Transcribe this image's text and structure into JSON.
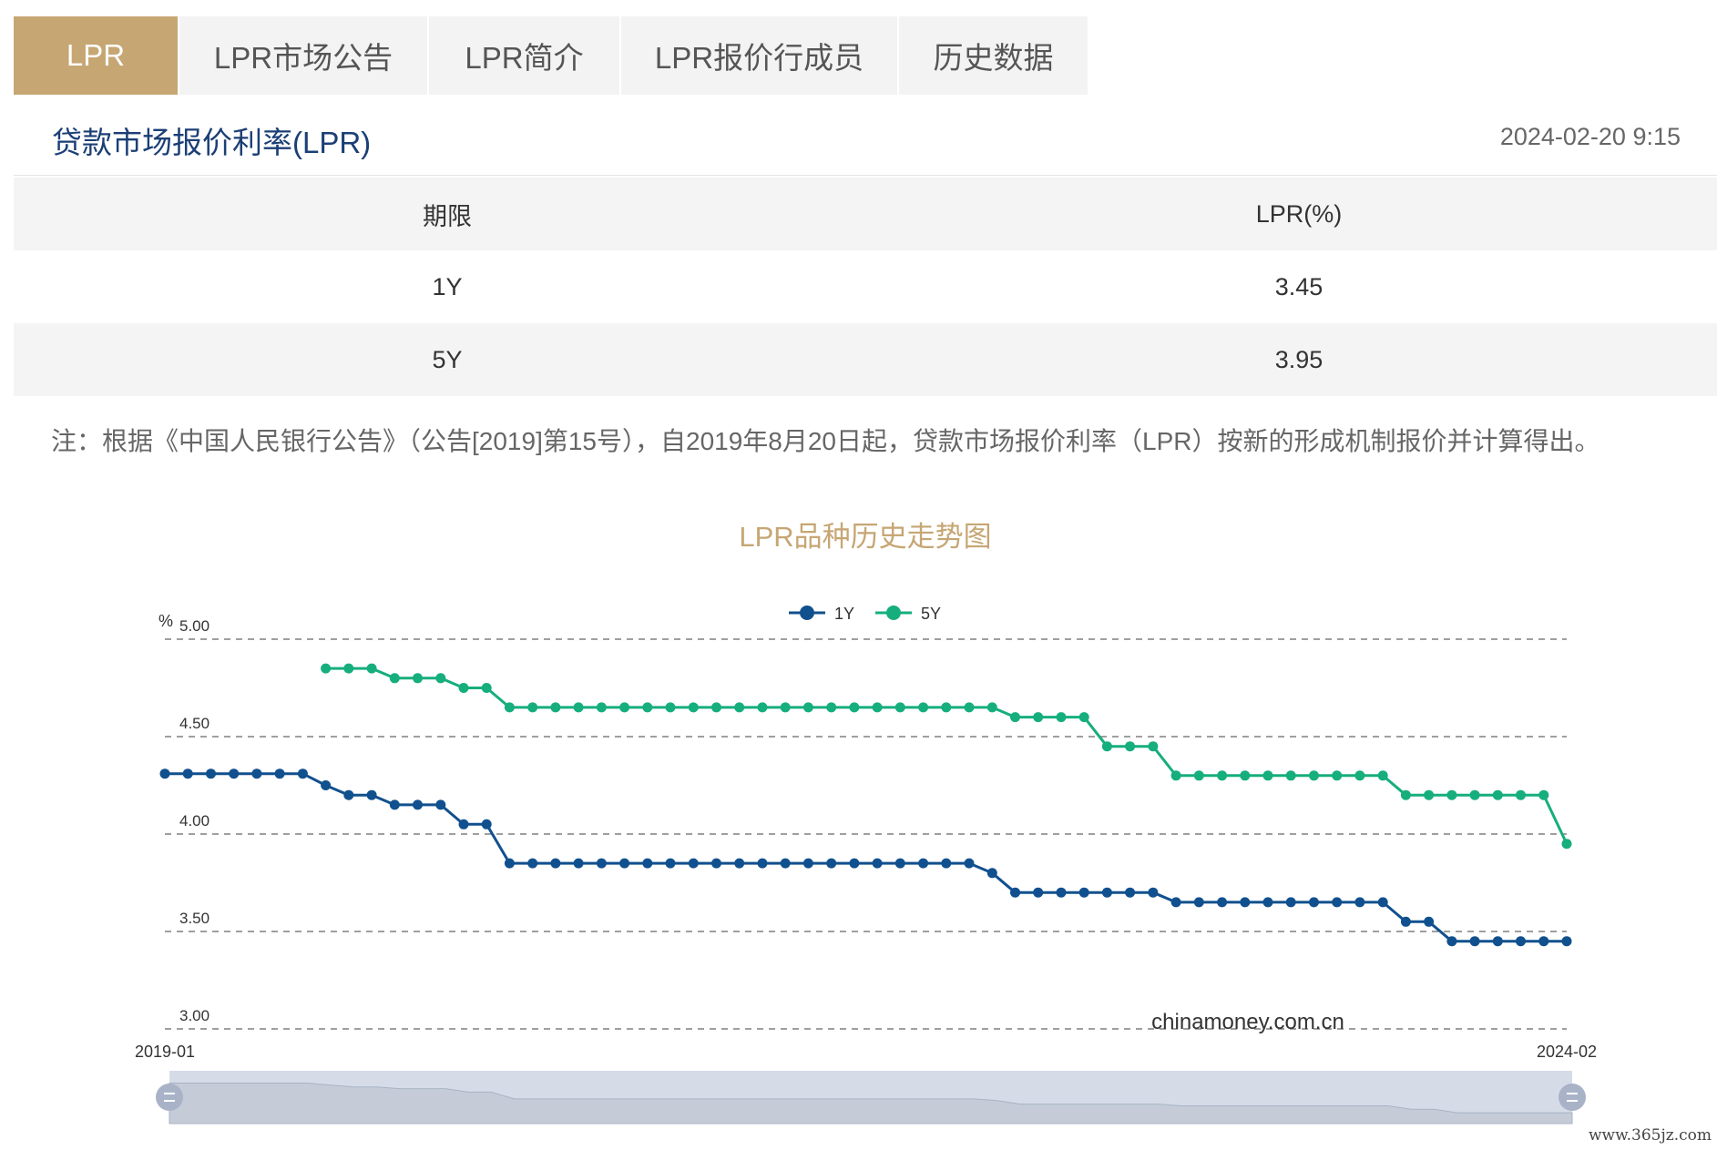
{
  "tabs": [
    {
      "label": "LPR",
      "active": true
    },
    {
      "label": "LPR市场公告",
      "active": false
    },
    {
      "label": "LPR简介",
      "active": false
    },
    {
      "label": "LPR报价行成员",
      "active": false
    },
    {
      "label": "历史数据",
      "active": false
    }
  ],
  "header": {
    "title": "贷款市场报价利率(LPR)",
    "timestamp": "2024-02-20 9:15"
  },
  "rate_table": {
    "headers": [
      "期限",
      "LPR(%)"
    ],
    "rows": [
      {
        "term": "1Y",
        "rate": "3.45"
      },
      {
        "term": "5Y",
        "rate": "3.95"
      }
    ]
  },
  "note": "注：根据《中国人民银行公告》（公告[2019]第15号），自2019年8月20日起，贷款市场报价利率（LPR）按新的形成机制报价并计算得出。",
  "site_watermark": "www.365jz.com",
  "colors": {
    "accent": "#c6a673",
    "title_blue": "#1b3f75",
    "series_1y": "#11508e",
    "series_5y": "#16ae7d"
  },
  "chart_data": {
    "type": "line",
    "title": "LPR品种历史走势图",
    "unit_label": "%",
    "watermark": "chinamoney.com.cn",
    "ylim": [
      3.0,
      5.0
    ],
    "y_ticks": [
      "5.00",
      "4.50",
      "4.00",
      "3.50",
      "3.00"
    ],
    "x_labels": [
      "2019-01",
      "2024-02"
    ],
    "grid": "horizontal-dashed",
    "legend_position": "top-center",
    "x": [
      "2019-01",
      "2019-02",
      "2019-03",
      "2019-04",
      "2019-05",
      "2019-06",
      "2019-07",
      "2019-08",
      "2019-09",
      "2019-10",
      "2019-11",
      "2019-12",
      "2020-01",
      "2020-02",
      "2020-03",
      "2020-04",
      "2020-05",
      "2020-06",
      "2020-07",
      "2020-08",
      "2020-09",
      "2020-10",
      "2020-11",
      "2020-12",
      "2021-01",
      "2021-02",
      "2021-03",
      "2021-04",
      "2021-05",
      "2021-06",
      "2021-07",
      "2021-08",
      "2021-09",
      "2021-10",
      "2021-11",
      "2021-12",
      "2022-01",
      "2022-02",
      "2022-03",
      "2022-04",
      "2022-05",
      "2022-06",
      "2022-07",
      "2022-08",
      "2022-09",
      "2022-10",
      "2022-11",
      "2022-12",
      "2023-01",
      "2023-02",
      "2023-03",
      "2023-04",
      "2023-05",
      "2023-06",
      "2023-07",
      "2023-08",
      "2023-09",
      "2023-10",
      "2023-11",
      "2023-12",
      "2024-01",
      "2024-02"
    ],
    "series": [
      {
        "name": "1Y",
        "values": [
          4.31,
          4.31,
          4.31,
          4.31,
          4.31,
          4.31,
          4.31,
          4.25,
          4.2,
          4.2,
          4.15,
          4.15,
          4.15,
          4.05,
          4.05,
          3.85,
          3.85,
          3.85,
          3.85,
          3.85,
          3.85,
          3.85,
          3.85,
          3.85,
          3.85,
          3.85,
          3.85,
          3.85,
          3.85,
          3.85,
          3.85,
          3.85,
          3.85,
          3.85,
          3.85,
          3.85,
          3.8,
          3.7,
          3.7,
          3.7,
          3.7,
          3.7,
          3.7,
          3.7,
          3.65,
          3.65,
          3.65,
          3.65,
          3.65,
          3.65,
          3.65,
          3.65,
          3.65,
          3.65,
          3.55,
          3.55,
          3.45,
          3.45,
          3.45,
          3.45,
          3.45,
          3.45
        ]
      },
      {
        "name": "5Y",
        "values": [
          null,
          null,
          null,
          null,
          null,
          null,
          null,
          4.85,
          4.85,
          4.85,
          4.8,
          4.8,
          4.8,
          4.75,
          4.75,
          4.65,
          4.65,
          4.65,
          4.65,
          4.65,
          4.65,
          4.65,
          4.65,
          4.65,
          4.65,
          4.65,
          4.65,
          4.65,
          4.65,
          4.65,
          4.65,
          4.65,
          4.65,
          4.65,
          4.65,
          4.65,
          4.65,
          4.6,
          4.6,
          4.6,
          4.6,
          4.45,
          4.45,
          4.45,
          4.3,
          4.3,
          4.3,
          4.3,
          4.3,
          4.3,
          4.3,
          4.3,
          4.3,
          4.3,
          4.2,
          4.2,
          4.2,
          4.2,
          4.2,
          4.2,
          4.2,
          3.95
        ]
      }
    ],
    "zoom_range": [
      "2019-01",
      "2024-02"
    ]
  }
}
